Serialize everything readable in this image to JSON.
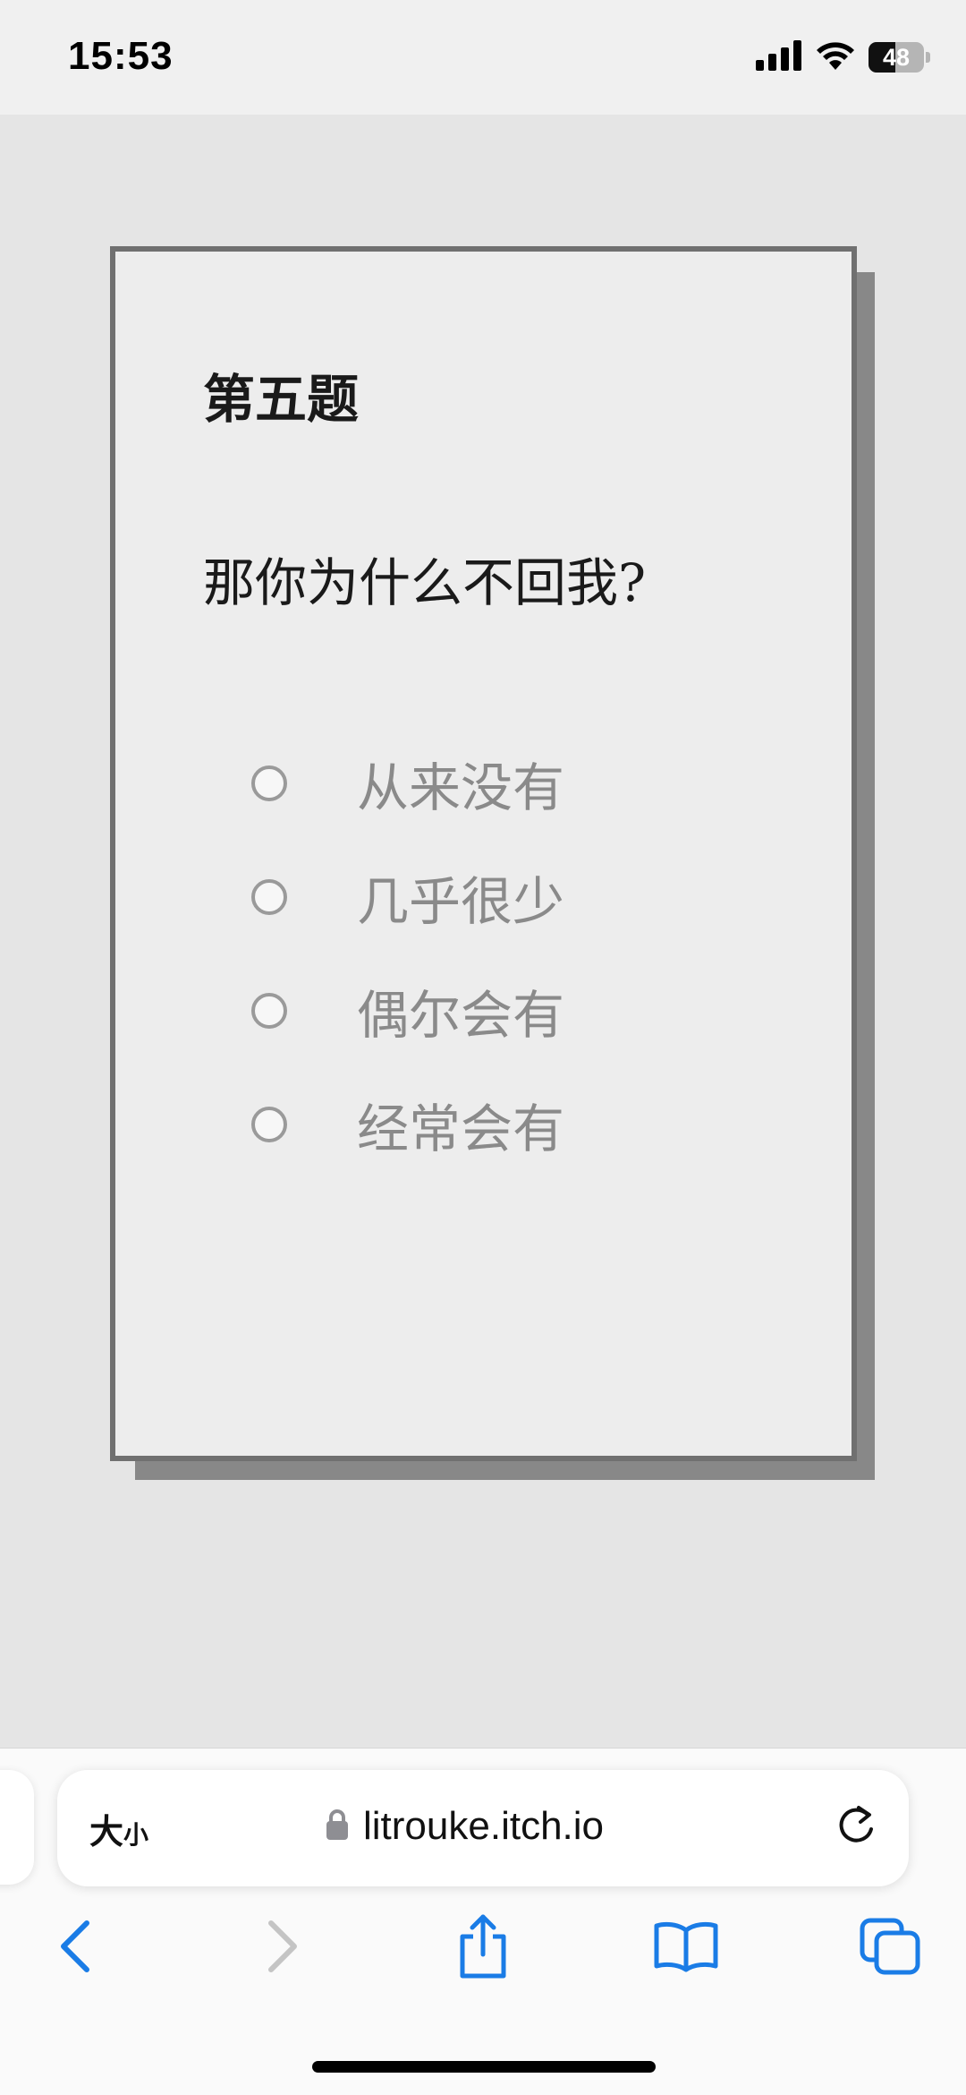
{
  "status_bar": {
    "time": "15:53",
    "battery_level": "48",
    "icons": [
      "signal-icon",
      "wifi-icon",
      "battery-icon"
    ]
  },
  "quiz": {
    "title": "第五题",
    "question": "那你为什么不回我?",
    "options": [
      "从来没有",
      "几乎很少",
      "偶尔会有",
      "经常会有"
    ],
    "selected_option": null
  },
  "browser": {
    "text_size_big": "大",
    "text_size_small": "小",
    "url": "litrouke.itch.io",
    "icons": [
      "lock-icon",
      "reload-icon",
      "back-icon",
      "forward-icon",
      "share-icon",
      "bookmarks-icon",
      "tabs-icon"
    ],
    "forward_enabled": false
  },
  "colors": {
    "accent": "#1a7ce6",
    "disabled": "#c4c4c4",
    "card_border": "#707070",
    "card_shadow": "#888888"
  }
}
